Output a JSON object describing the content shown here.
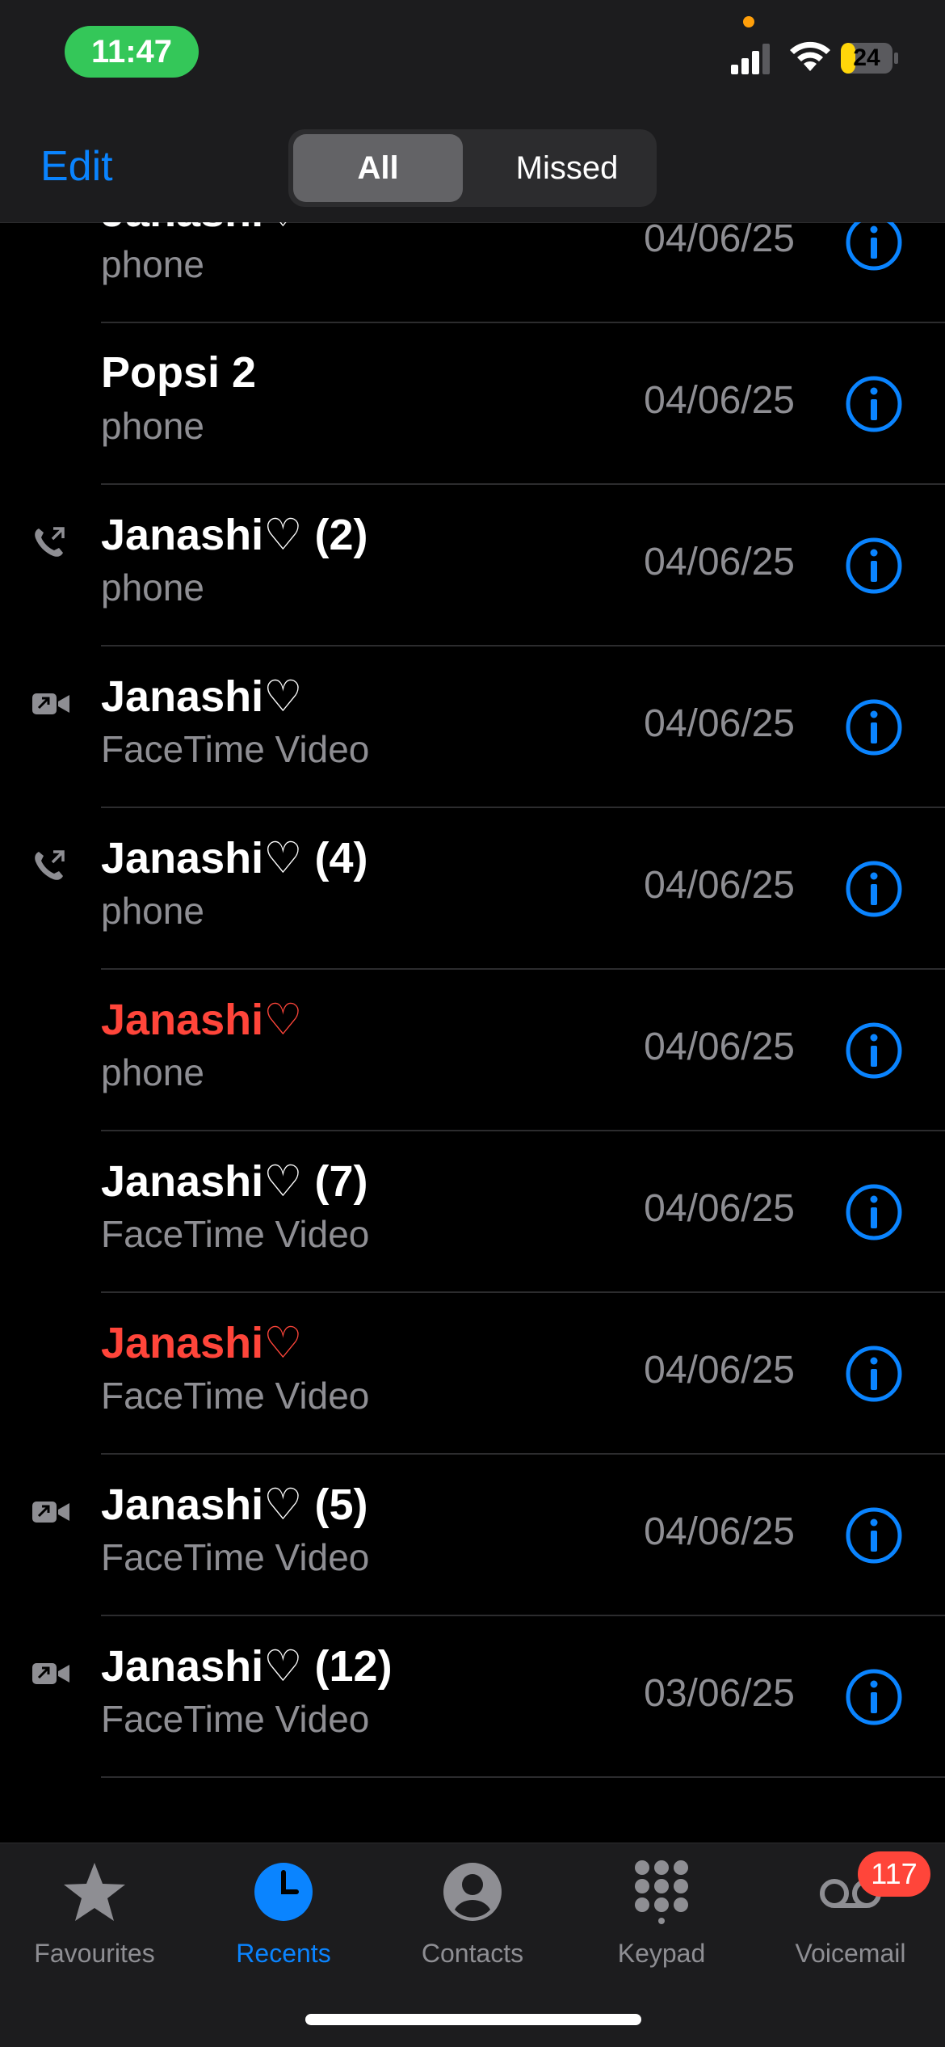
{
  "status": {
    "time": "11:47",
    "battery": "24"
  },
  "header": {
    "edit_label": "Edit",
    "segments": [
      {
        "label": "All"
      },
      {
        "label": "Missed"
      }
    ]
  },
  "calls": [
    {
      "name": "Janashi♡",
      "type": "phone",
      "date": "04/06/25",
      "missed": false,
      "icon": ""
    },
    {
      "name": "Popsi 2",
      "type": "phone",
      "date": "04/06/25",
      "missed": false,
      "icon": ""
    },
    {
      "name": "Janashi♡ (2)",
      "type": "phone",
      "date": "04/06/25",
      "missed": false,
      "icon": "outgoing-call-icon"
    },
    {
      "name": "Janashi♡",
      "type": "FaceTime Video",
      "date": "04/06/25",
      "missed": false,
      "icon": "outgoing-video-icon"
    },
    {
      "name": "Janashi♡ (4)",
      "type": "phone",
      "date": "04/06/25",
      "missed": false,
      "icon": "outgoing-call-icon"
    },
    {
      "name": "Janashi♡",
      "type": "phone",
      "date": "04/06/25",
      "missed": true,
      "icon": ""
    },
    {
      "name": "Janashi♡ (7)",
      "type": "FaceTime Video",
      "date": "04/06/25",
      "missed": false,
      "icon": ""
    },
    {
      "name": "Janashi♡",
      "type": "FaceTime Video",
      "date": "04/06/25",
      "missed": true,
      "icon": ""
    },
    {
      "name": "Janashi♡ (5)",
      "type": "FaceTime Video",
      "date": "04/06/25",
      "missed": false,
      "icon": "outgoing-video-icon"
    },
    {
      "name": "Janashi♡ (12)",
      "type": "FaceTime Video",
      "date": "03/06/25",
      "missed": false,
      "icon": "outgoing-video-icon"
    }
  ],
  "tabs": [
    {
      "label": "Favourites",
      "icon": "star-icon",
      "active": false
    },
    {
      "label": "Recents",
      "icon": "clock-icon",
      "active": true
    },
    {
      "label": "Contacts",
      "icon": "person-circle-icon",
      "active": false
    },
    {
      "label": "Keypad",
      "icon": "keypad-icon",
      "active": false
    },
    {
      "label": "Voicemail",
      "icon": "voicemail-icon",
      "active": false
    }
  ],
  "voicemail_badge": "117",
  "colors": {
    "accent": "#0a84ff",
    "missed": "#ff453a",
    "secondary": "#8e8e93",
    "status_pill": "#34c759"
  }
}
